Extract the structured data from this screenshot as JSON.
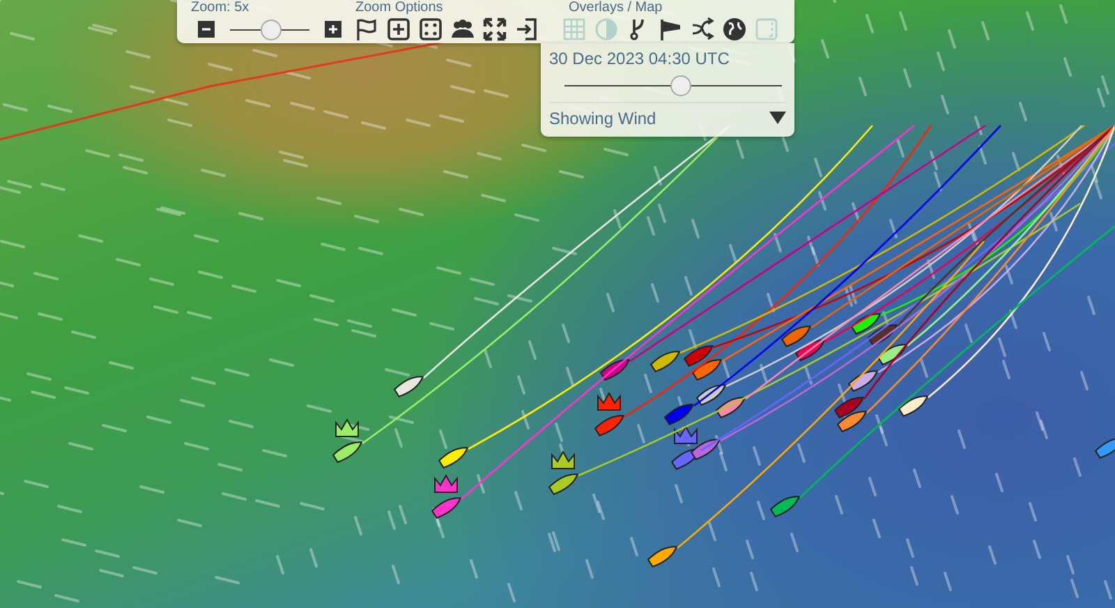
{
  "toolbar": {
    "zoom": {
      "label": "Zoom: 5x",
      "level": 0.5
    },
    "zoom_options": {
      "label": "Zoom Options"
    },
    "overlays": {
      "label": "Overlays / Map",
      "items": [
        {
          "on": false
        },
        {
          "on": false
        },
        {
          "on": true
        },
        {
          "on": true
        },
        {
          "on": true
        },
        {
          "on": true
        },
        {
          "on": false
        }
      ]
    }
  },
  "time_panel": {
    "time": "30 Dec 2023 04:30 UTC",
    "level": 0.53,
    "layer": "Showing Wind"
  },
  "boats": [
    {
      "color": "#e8e8e0",
      "leader": false
    },
    {
      "color": "#99ee66",
      "leader": true
    },
    {
      "color": "#ffee00",
      "leader": false
    },
    {
      "color": "#ff33cc",
      "leader": true
    },
    {
      "color": "#aacc22",
      "leader": true
    },
    {
      "color": "#ff2200",
      "leader": true
    },
    {
      "color": "#cc0088",
      "leader": false
    },
    {
      "color": "#ccbb00",
      "leader": false
    },
    {
      "color": "#cc0000",
      "leader": false
    },
    {
      "color": "#ff6600",
      "leader": false
    },
    {
      "color": "#0000ee",
      "leader": false
    },
    {
      "color": "#cccccc",
      "leader": false
    },
    {
      "color": "#ff88aa",
      "leader": false
    },
    {
      "color": "#6666ff",
      "leader": true
    },
    {
      "color": "#bb66dd",
      "leader": false
    },
    {
      "color": "#ee6600",
      "leader": false
    },
    {
      "color": "#ee0055",
      "leader": false
    },
    {
      "color": "#22ee00",
      "leader": false
    },
    {
      "color": "#553322",
      "leader": false
    },
    {
      "color": "#99ee88",
      "leader": false
    },
    {
      "color": "#ccaaee",
      "leader": false
    },
    {
      "color": "#aa0022",
      "leader": false
    },
    {
      "color": "#ff8833",
      "leader": false
    },
    {
      "color": "#ffeecc",
      "leader": false
    },
    {
      "color": "#00bb55",
      "leader": false
    },
    {
      "color": "#ffaa00",
      "leader": false
    },
    {
      "color": "#3399ff",
      "leader": false
    }
  ]
}
